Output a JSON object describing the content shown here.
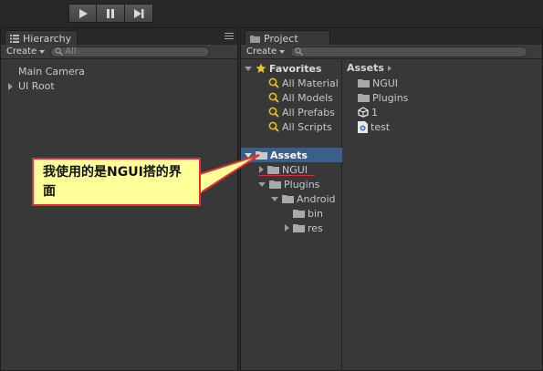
{
  "toolbar": {
    "buttons": [
      "play-icon",
      "pause-icon",
      "step-icon"
    ]
  },
  "hierarchy": {
    "tab_label": "Hierarchy",
    "create_label": "Create",
    "search_placeholder": "All",
    "items": [
      {
        "label": "Main Camera",
        "expandable": false
      },
      {
        "label": "UI Root",
        "expandable": true
      }
    ]
  },
  "project": {
    "tab_label": "Project",
    "create_label": "Create",
    "favorites": {
      "label": "Favorites",
      "items": [
        "All Material",
        "All Models",
        "All Prefabs",
        "All Scripts"
      ]
    },
    "assets_tree": {
      "label": "Assets",
      "ngui": "NGUI",
      "plugins": "Plugins",
      "android": "Android",
      "bin": "bin",
      "res": "res"
    },
    "breadcrumb": "Assets",
    "files": [
      {
        "label": "NGUI",
        "icon": "folder-icon"
      },
      {
        "label": "Plugins",
        "icon": "folder-icon"
      },
      {
        "label": "1",
        "icon": "unity-scene-icon"
      },
      {
        "label": "test",
        "icon": "csharp-script-icon"
      }
    ]
  },
  "callout": {
    "text": "我使用的是NGUI搭的界面"
  },
  "colors": {
    "selection": "#3c5e8a",
    "callout_bg": "#ffff99",
    "callout_border": "#e03030"
  }
}
